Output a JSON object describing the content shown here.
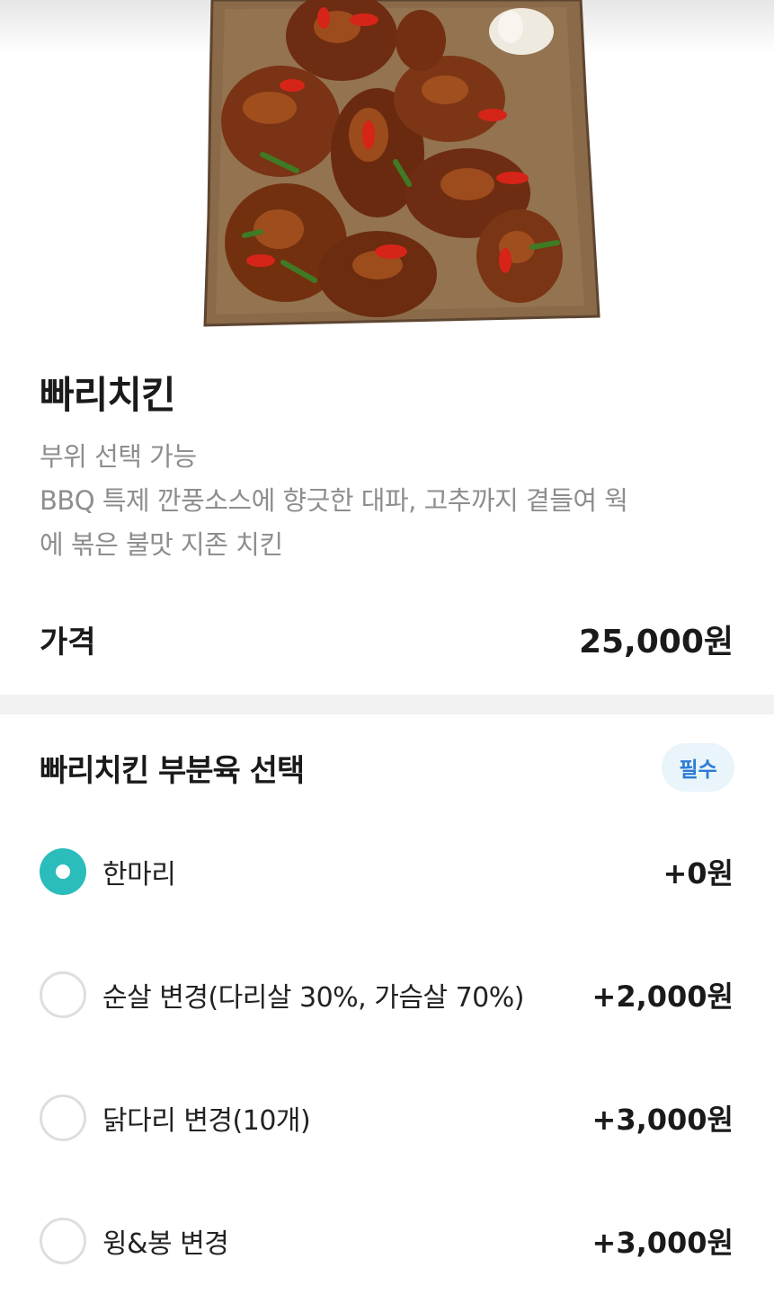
{
  "product": {
    "name": "빠리치킨",
    "description_lines": [
      "부위 선택 가능",
      "BBQ 특제 깐풍소스에 향긋한 대파, 고추까지 곁들여 웍",
      "에 볶은 불맛 지존 치킨"
    ],
    "price_label": "가격",
    "price": "25,000원"
  },
  "option_group": {
    "title": "빠리치킨 부분육 선택",
    "required_badge": "필수",
    "options": [
      {
        "label": "한마리",
        "price": "+0원",
        "selected": true
      },
      {
        "label": "순살 변경(다리살 30%, 가슴살 70%)",
        "price": "+2,000원",
        "selected": false
      },
      {
        "label": "닭다리 변경(10개)",
        "price": "+3,000원",
        "selected": false
      },
      {
        "label": "윙&봉 변경",
        "price": "+3,000원",
        "selected": false
      }
    ]
  },
  "colors": {
    "accent": "#2bbcbc",
    "badge_text": "#2b7bd4",
    "badge_bg": "#e9f4fb",
    "muted_text": "#8e8e8e"
  }
}
